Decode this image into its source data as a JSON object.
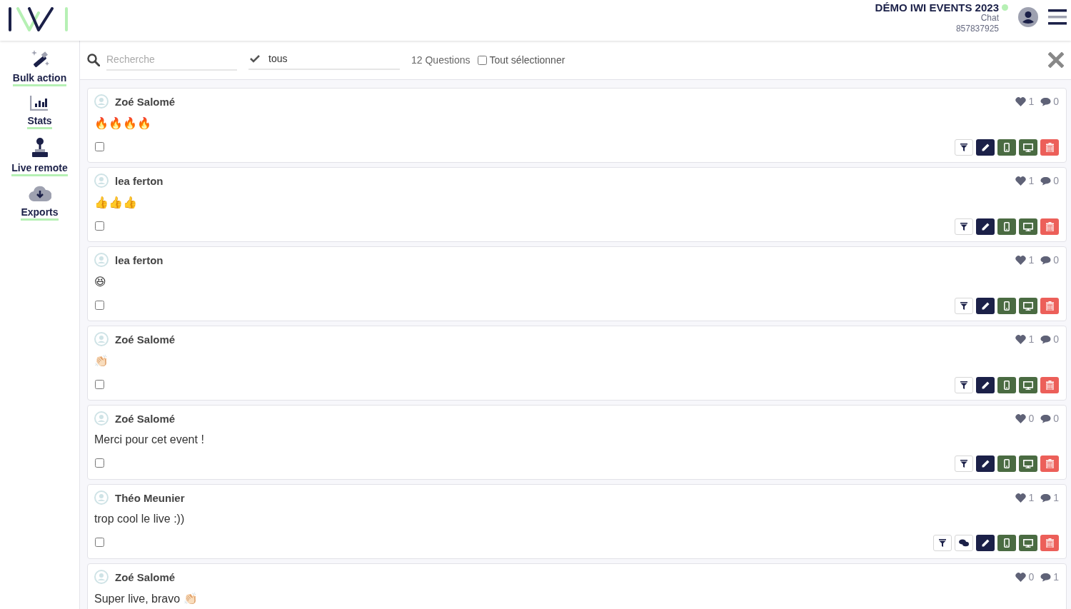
{
  "header": {
    "event_title": "DÉMO IWI EVENTS 2023",
    "online": true,
    "module": "Chat",
    "code": "857837925"
  },
  "sidebar": {
    "items": [
      {
        "kind": "bulk",
        "label": "Bulk action"
      },
      {
        "kind": "stats",
        "label": "Stats"
      },
      {
        "kind": "remote",
        "label": "Live remote"
      },
      {
        "kind": "exports",
        "label": "Exports"
      }
    ]
  },
  "toolbar": {
    "search": {
      "placeholder": "Recherche"
    },
    "filter": {
      "value": "tous"
    },
    "count": "12 Questions",
    "select_all": {
      "label": "Tout sélectionner",
      "checked": false
    }
  },
  "questions": [
    {
      "author": "Zoé Salomé",
      "text": "🔥🔥🔥🔥",
      "checked": false,
      "likes": "1",
      "comments": "0",
      "actions": [
        {
          "kind": "filter"
        },
        {
          "kind": "edit"
        },
        {
          "kind": "mobile"
        },
        {
          "kind": "screen"
        },
        {
          "kind": "delete"
        }
      ]
    },
    {
      "author": "lea ferton",
      "text": "👍👍👍",
      "checked": false,
      "likes": "1",
      "comments": "0",
      "actions": [
        {
          "kind": "filter"
        },
        {
          "kind": "edit"
        },
        {
          "kind": "mobile"
        },
        {
          "kind": "screen"
        },
        {
          "kind": "delete"
        }
      ]
    },
    {
      "author": "lea ferton",
      "text": "😆",
      "checked": false,
      "likes": "1",
      "comments": "0",
      "actions": [
        {
          "kind": "filter"
        },
        {
          "kind": "edit"
        },
        {
          "kind": "mobile"
        },
        {
          "kind": "screen"
        },
        {
          "kind": "delete"
        }
      ]
    },
    {
      "author": "Zoé Salomé",
      "text": "👏🏻",
      "checked": false,
      "likes": "1",
      "comments": "0",
      "actions": [
        {
          "kind": "filter"
        },
        {
          "kind": "edit"
        },
        {
          "kind": "mobile"
        },
        {
          "kind": "screen"
        },
        {
          "kind": "delete"
        }
      ]
    },
    {
      "author": "Zoé Salomé",
      "text": "Merci pour cet event !",
      "checked": false,
      "likes": "0",
      "comments": "0",
      "actions": [
        {
          "kind": "filter"
        },
        {
          "kind": "edit"
        },
        {
          "kind": "mobile"
        },
        {
          "kind": "screen"
        },
        {
          "kind": "delete"
        }
      ]
    },
    {
      "author": "Théo Meunier",
      "text": "trop cool le live :))",
      "checked": false,
      "likes": "1",
      "comments": "1",
      "actions": [
        {
          "kind": "filter"
        },
        {
          "kind": "reply"
        },
        {
          "kind": "edit"
        },
        {
          "kind": "mobile"
        },
        {
          "kind": "screen"
        },
        {
          "kind": "delete"
        }
      ]
    },
    {
      "author": "Zoé Salomé",
      "text": "Super live, bravo 👏🏻",
      "likes": "0",
      "comments": "1"
    }
  ]
}
